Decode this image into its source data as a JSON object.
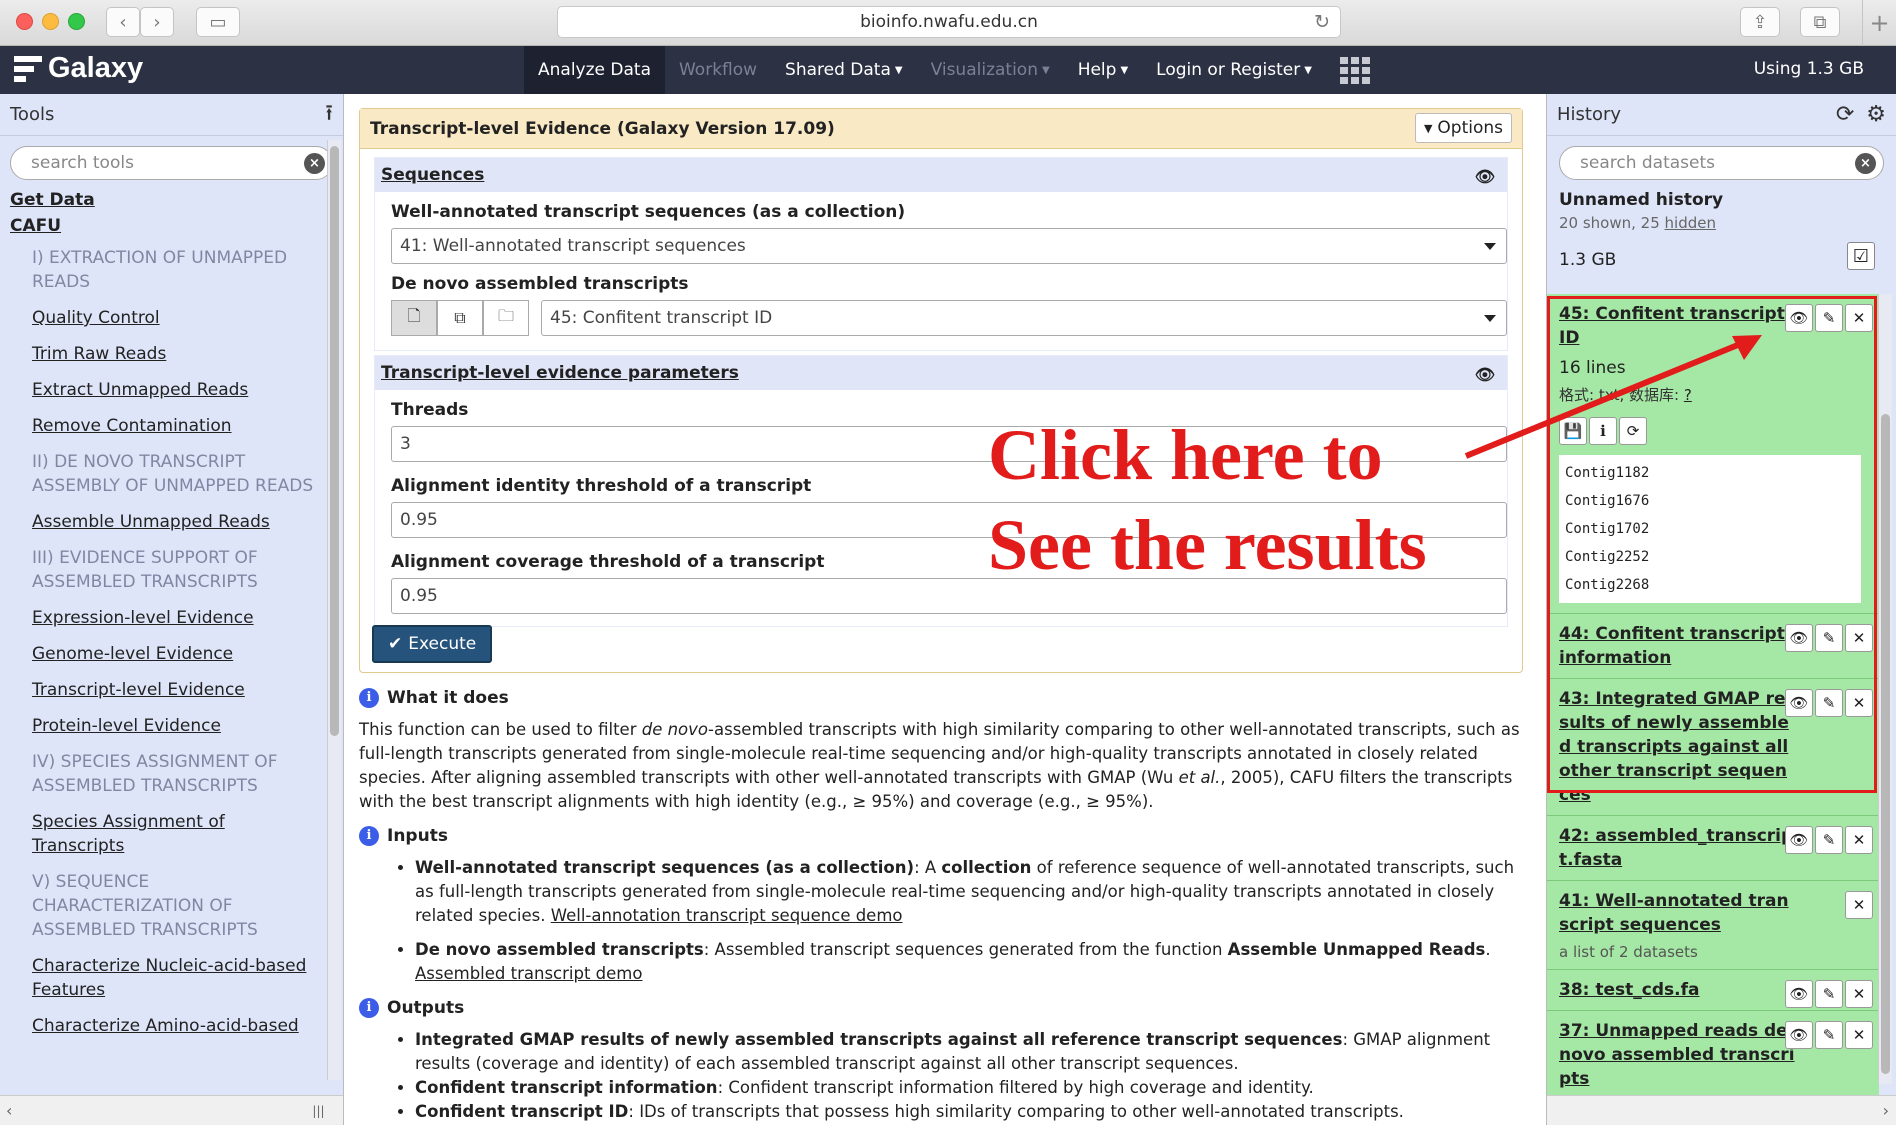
{
  "browser": {
    "url": "bioinfo.nwafu.edu.cn"
  },
  "masthead": {
    "brand": "Galaxy",
    "nav": [
      {
        "label": "Analyze Data",
        "active": true,
        "caret": false
      },
      {
        "label": "Workflow",
        "disabled": true,
        "caret": false
      },
      {
        "label": "Shared Data",
        "caret": true
      },
      {
        "label": "Visualization",
        "disabled": true,
        "caret": true
      },
      {
        "label": "Help",
        "caret": true
      },
      {
        "label": "Login or Register",
        "caret": true
      }
    ],
    "quota": "Using 1.3 GB"
  },
  "tools": {
    "title": "Tools",
    "search_placeholder": "search tools",
    "items": [
      {
        "kind": "section",
        "text": "Get Data"
      },
      {
        "kind": "section",
        "text": "CAFU"
      },
      {
        "kind": "label",
        "text": "I) EXTRACTION OF UNMAPPED READS"
      },
      {
        "kind": "link",
        "text": "Quality Control"
      },
      {
        "kind": "link",
        "text": "Trim Raw Reads"
      },
      {
        "kind": "link",
        "text": "Extract Unmapped Reads"
      },
      {
        "kind": "link",
        "text": "Remove Contamination"
      },
      {
        "kind": "label",
        "text": "II) DE NOVO TRANSCRIPT ASSEMBLY OF UNMAPPED READS"
      },
      {
        "kind": "link",
        "text": "Assemble Unmapped Reads"
      },
      {
        "kind": "label",
        "text": "III) EVIDENCE SUPPORT OF ASSEMBLED TRANSCRIPTS"
      },
      {
        "kind": "link",
        "text": "Expression-level Evidence"
      },
      {
        "kind": "link",
        "text": "Genome-level Evidence"
      },
      {
        "kind": "link",
        "text": "Transcript-level Evidence"
      },
      {
        "kind": "link",
        "text": "Protein-level Evidence"
      },
      {
        "kind": "label",
        "text": "IV) SPECIES ASSIGNMENT OF ASSEMBLED TRANSCRIPTS"
      },
      {
        "kind": "link",
        "text": "Species Assignment of Transcripts"
      },
      {
        "kind": "label",
        "text": "V) SEQUENCE CHARACTERIZATION OF ASSEMBLED TRANSCRIPTS"
      },
      {
        "kind": "link",
        "text": "Characterize Nucleic-acid-based Features"
      },
      {
        "kind": "link",
        "text": "Characterize Amino-acid-based"
      }
    ]
  },
  "form": {
    "title": "Transcript-level Evidence (Galaxy Version 17.09)",
    "options_label": "Options",
    "sequences_section": "Sequences",
    "wellannotated_label": "Well-annotated transcript sequences (as a collection)",
    "wellannotated_value": "41: Well-annotated transcript sequences",
    "denovo_label": "De novo assembled transcripts",
    "denovo_value": "45: Confitent transcript ID",
    "params_section": "Transcript-level evidence parameters",
    "threads_label": "Threads",
    "threads_value": "3",
    "identity_label": "Alignment identity threshold of a transcript",
    "identity_value": "0.95",
    "coverage_label": "Alignment coverage threshold of a transcript",
    "coverage_value": "0.95",
    "execute_label": "Execute"
  },
  "help": {
    "what_head": "What it does",
    "what_text_1": "This function can be used to filter ",
    "what_text_em": "de novo",
    "what_text_2": "-assembled transcripts with high similarity comparing to other well-annotated transcripts, such as full-length transcripts generated from single-molecule real-time sequencing and/or high-quality transcripts annotated in closely related species. After aligning assembled transcripts with other well-annotated transcripts with GMAP (Wu ",
    "what_text_em2": "et al.",
    "what_text_3": ", 2005), CAFU filters the transcripts with the best transcript alignments with high identity (e.g., ≥ 95%) and coverage (e.g., ≥ 95%).",
    "inputs_head": "Inputs",
    "input1_bold": "Well-annotated transcript sequences (as a collection)",
    "input1_text_a": ": A ",
    "input1_bold2": "collection",
    "input1_text_b": " of reference sequence of well-annotated transcripts, such as full-length transcripts generated from single-molecule real-time sequencing and/or high-quality transcripts annotated in closely related species. ",
    "input1_link": "Well-annotation transcript sequence demo",
    "input2_bold": "De novo assembled transcripts",
    "input2_text": ": Assembled transcript sequences generated from the function ",
    "input2_bold2": "Assemble Unmapped Reads",
    "input2_text2": ".",
    "input2_link": "Assembled transcript demo",
    "outputs_head": "Outputs",
    "output1_bold": "Integrated GMAP results of newly assembled transcripts against all reference transcript sequences",
    "output1_text": ": GMAP alignment results (coverage and identity) of each assembled transcript against all other transcript sequences.",
    "output2_bold": "Confident transcript information",
    "output2_text": ": Confident transcript information filtered by high coverage and identity.",
    "output3_bold": "Confident transcript ID",
    "output3_text": ": IDs of transcripts that possess high similarity comparing to other well-annotated transcripts."
  },
  "history": {
    "title": "History",
    "search_placeholder": "search datasets",
    "name": "Unnamed history",
    "shown": "20 shown, 25 ",
    "hidden": "hidden",
    "size": "1.3 GB",
    "datasets": [
      {
        "title": "45: Confitent transcript ID",
        "lines": "16 lines",
        "meta_a": "格式: txt, 数据库: ",
        "meta_q": "?",
        "peek": [
          "Contig1182",
          "Contig1676",
          "Contig1702",
          "Contig2252",
          "Contig2268"
        ],
        "buttons": 3
      },
      {
        "title": "44: Confitent transcript information",
        "buttons": 3
      },
      {
        "title": "43: Integrated GMAP results of newly assembled transcripts against all other transcript sequences",
        "buttons": 3
      },
      {
        "title": "42: assembled_transcript.fasta",
        "buttons": 3
      },
      {
        "title": "41: Well-annotated transcript sequences",
        "sub": "a list of 2 datasets",
        "buttons": 1
      },
      {
        "title": "38: test_cds.fa",
        "buttons": 3
      },
      {
        "title": "37: Unmapped reads de novo assembled transcripts",
        "buttons": 3
      }
    ]
  },
  "annotation": {
    "line1": "Click here to",
    "line2": "See the results",
    "color": "#e21b1b"
  }
}
